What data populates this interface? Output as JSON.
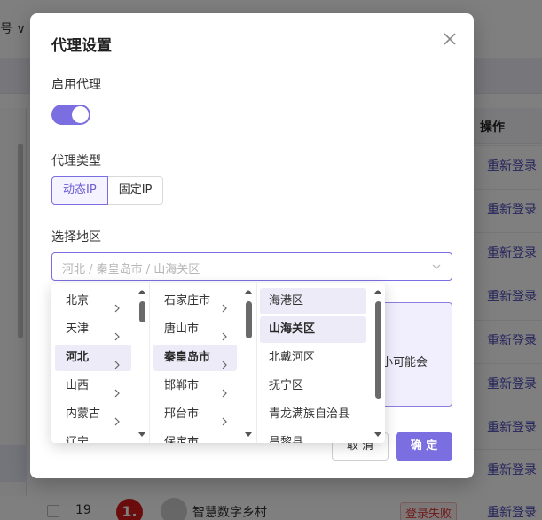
{
  "background": {
    "account_label": "号 ∨",
    "column_action_header": "操作",
    "relogin_label": "重新登录",
    "row": {
      "index": "19",
      "rank_badge": "1.",
      "name": "智慧数字乡村",
      "status": "登录失败",
      "action": "重新登录"
    }
  },
  "modal": {
    "title": "代理设置",
    "enable_label": "启用代理",
    "enable_on": true,
    "type_label": "代理类型",
    "types": [
      "动态IP",
      "固定IP"
    ],
    "selected_type": "动态IP",
    "region_label": "选择地区",
    "region_placeholder": "河北 / 秦皇岛市 / 山海关区",
    "info_text": "小可能会",
    "cancel_label": "取 消",
    "ok_label": "确 定"
  },
  "cascader": {
    "provinces": [
      "北京",
      "天津",
      "河北",
      "山西",
      "内蒙古",
      "辽宁"
    ],
    "selected_province": "河北",
    "cities": [
      "石家庄市",
      "唐山市",
      "秦皇岛市",
      "邯郸市",
      "邢台市",
      "保定市"
    ],
    "selected_city": "秦皇岛市",
    "districts": [
      "海港区",
      "山海关区",
      "北戴河区",
      "抚宁区",
      "青龙满族自治县",
      "昌黎县"
    ],
    "selected_district": "山海关区"
  },
  "colors": {
    "accent": "#7b6ee0",
    "selected_bg": "#edebf8",
    "link": "#4a4ab8",
    "error": "#e03a3a"
  },
  "icons": {
    "close": "close-icon",
    "chevron": "chevron-right-icon",
    "dropdown": "chevron-down-icon"
  }
}
